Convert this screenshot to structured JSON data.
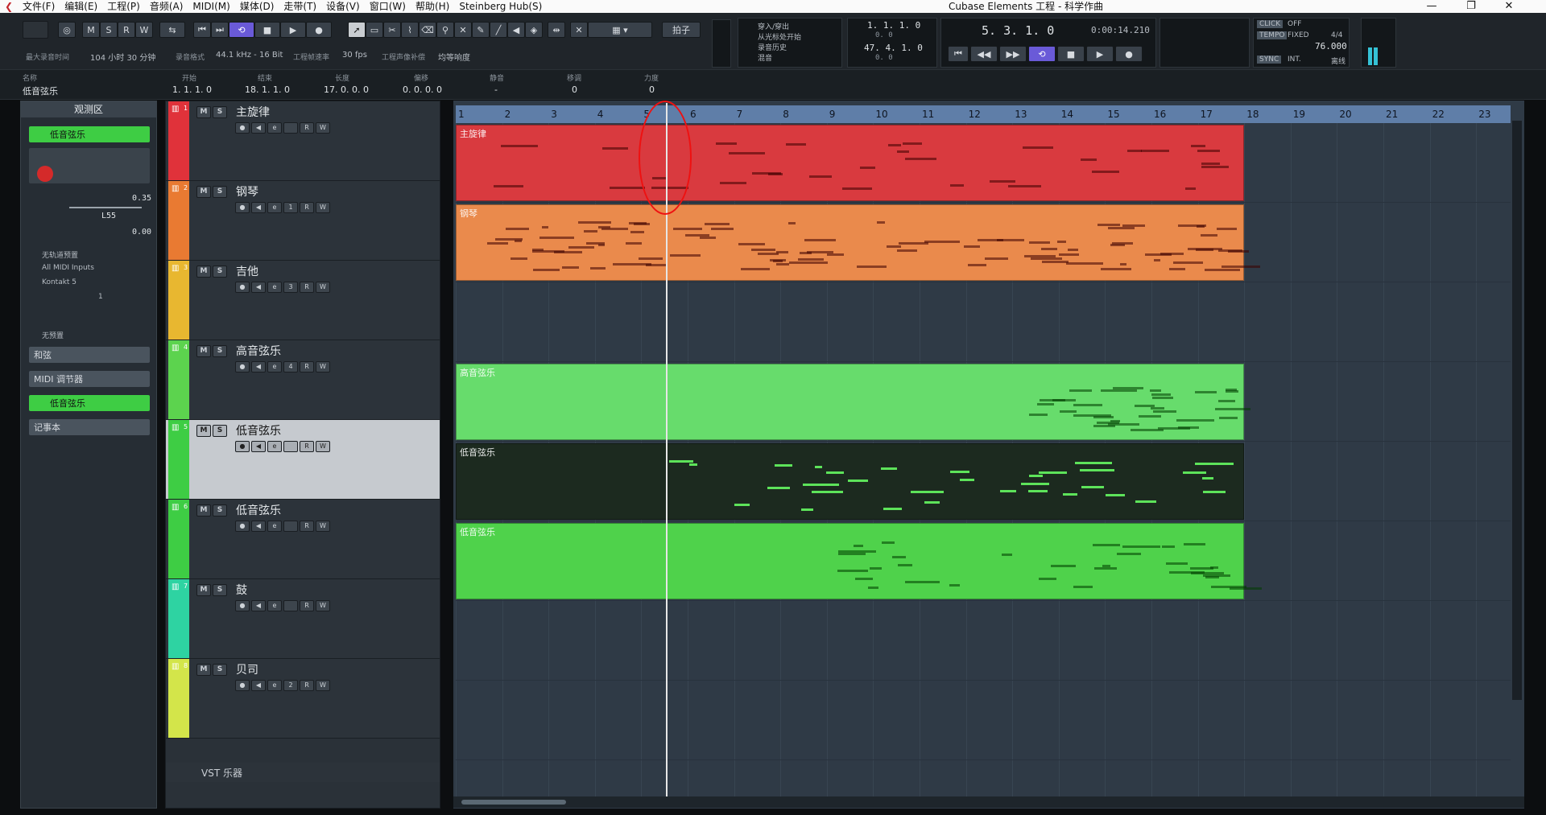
{
  "menubar": {
    "items": [
      "文件(F)",
      "编辑(E)",
      "工程(P)",
      "音频(A)",
      "MIDI(M)",
      "媒体(D)",
      "走带(T)",
      "设备(V)",
      "窗口(W)",
      "帮助(H)",
      "Steinberg Hub(S)"
    ],
    "title": "Cubase Elements 工程 - 科学作曲",
    "min": "—",
    "restore": "❐",
    "close": "✕"
  },
  "toolbar": {
    "msrw": [
      "M",
      "S",
      "R",
      "W"
    ],
    "beat_label": "拍子",
    "punch": [
      "穿入/穿出",
      "从光标处开始",
      "录音历史",
      "混音"
    ],
    "locL": "1. 1. 1.   0",
    "locL2": "0.   0",
    "locR": "47. 4. 1.   0",
    "locR2": "0.   0",
    "position": "5. 3. 1.   0",
    "time": "0:00:14.210",
    "click": "CLICK",
    "click_val": "OFF",
    "tempo": "TEMPO",
    "tempo_mode": "FIXED",
    "tempo_val": "76.000",
    "signature": "4/4",
    "sync": "SYNC",
    "sync_val": "INT.",
    "sync_state": "离线"
  },
  "statusline": {
    "rec_time_label": "最大录音时间",
    "rec_time": "104 小时 30 分钟",
    "format_label": "录音格式",
    "format": "44.1 kHz - 16 Bit",
    "fps_label": "工程帧速率",
    "fps": "30 fps",
    "pan_label": "工程声像补偿",
    "pan": "均等响度"
  },
  "infoline": {
    "name_label": "名称",
    "name": "低音弦乐",
    "start_label": "开始",
    "start": "1. 1. 1.   0",
    "end_label": "结束",
    "end": "18. 1. 1.   0",
    "length_label": "长度",
    "length": "17. 0. 0.   0",
    "offset_label": "偏移",
    "offset": "0. 0. 0.   0",
    "mute_label": "静音",
    "mute": "-",
    "transpose_label": "移调",
    "transpose": "0",
    "velocity_label": "力度",
    "velocity": "0"
  },
  "inspector": {
    "title": "观测区",
    "track_name": "低音弦乐",
    "vol": "0.35",
    "pan": "L55",
    "delay": "0.00",
    "in_none": "无轨道预置",
    "midi_in": "All MIDI Inputs",
    "instrument": "Kontakt 5",
    "channel": "1",
    "program_none": "无预置",
    "sections": [
      "和弦",
      "MIDI 调节器",
      "低音弦乐",
      "记事本"
    ]
  },
  "tracks": [
    {
      "num": "1",
      "name": "主旋律",
      "ch": "",
      "color": "#e0323a",
      "part_color": "#d93a3f"
    },
    {
      "num": "2",
      "name": "钢琴",
      "ch": "1",
      "color": "#e97a32",
      "part_color": "#ea8a4c"
    },
    {
      "num": "3",
      "name": "吉他",
      "ch": "3",
      "color": "#e8b730",
      "part_color": ""
    },
    {
      "num": "4",
      "name": "高音弦乐",
      "ch": "4",
      "color": "#5cd34e",
      "part_color": "#67dc6c"
    },
    {
      "num": "5",
      "name": "低音弦乐",
      "ch": "",
      "color": "#3ecd44",
      "part_color": "#1c2a1f"
    },
    {
      "num": "6",
      "name": "低音弦乐",
      "ch": "",
      "color": "#3ecd44",
      "part_color": "#4fd24b"
    },
    {
      "num": "7",
      "name": "鼓",
      "ch": "",
      "color": "#2ed3a2",
      "part_color": ""
    },
    {
      "num": "8",
      "name": "贝司",
      "ch": "2",
      "color": "#d3e54a",
      "part_color": ""
    }
  ],
  "vst_folder": "VST 乐器",
  "ruler": [
    "1",
    "2",
    "3",
    "4",
    "5",
    "6",
    "7",
    "8",
    "9",
    "10",
    "11",
    "12",
    "13",
    "14",
    "15",
    "16",
    "17",
    "18",
    "19",
    "20",
    "21",
    "22",
    "23"
  ],
  "parts": [
    "主旋律",
    "钢琴",
    "",
    "高音弦乐",
    "低音弦乐",
    "低音弦乐",
    "",
    ""
  ]
}
